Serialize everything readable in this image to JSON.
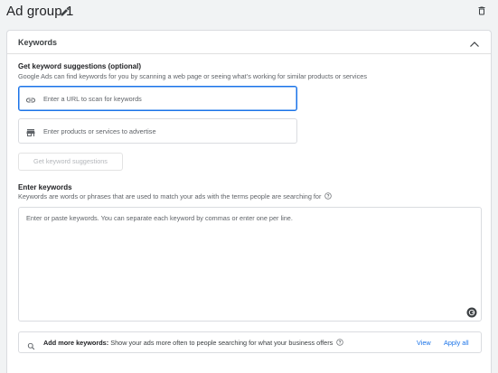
{
  "header": {
    "title": "Ad group 1"
  },
  "card": {
    "title": "Keywords"
  },
  "suggestions": {
    "title": "Get keyword suggestions (optional)",
    "description": "Google Ads can find keywords for you by scanning a web page or seeing what’s working for similar products or services",
    "url_placeholder": "Enter a URL to scan for keywords",
    "products_placeholder": "Enter products or services to advertise",
    "button_label": "Get keyword suggestions"
  },
  "keywords": {
    "title": "Enter keywords",
    "description": "Keywords are words or phrases that are used to match your ads with the terms people are searching for",
    "textarea_placeholder": "Enter or paste keywords. You can separate each keyword by commas or enter one per line."
  },
  "more_keywords": {
    "label": "Add more keywords:",
    "text": "Show your ads more often to people searching for what your business offers",
    "view_label": "View",
    "apply_label": "Apply all"
  },
  "colors": {
    "accent": "#1a73e8",
    "background": "#f1f3f4",
    "border": "#dadce0"
  }
}
